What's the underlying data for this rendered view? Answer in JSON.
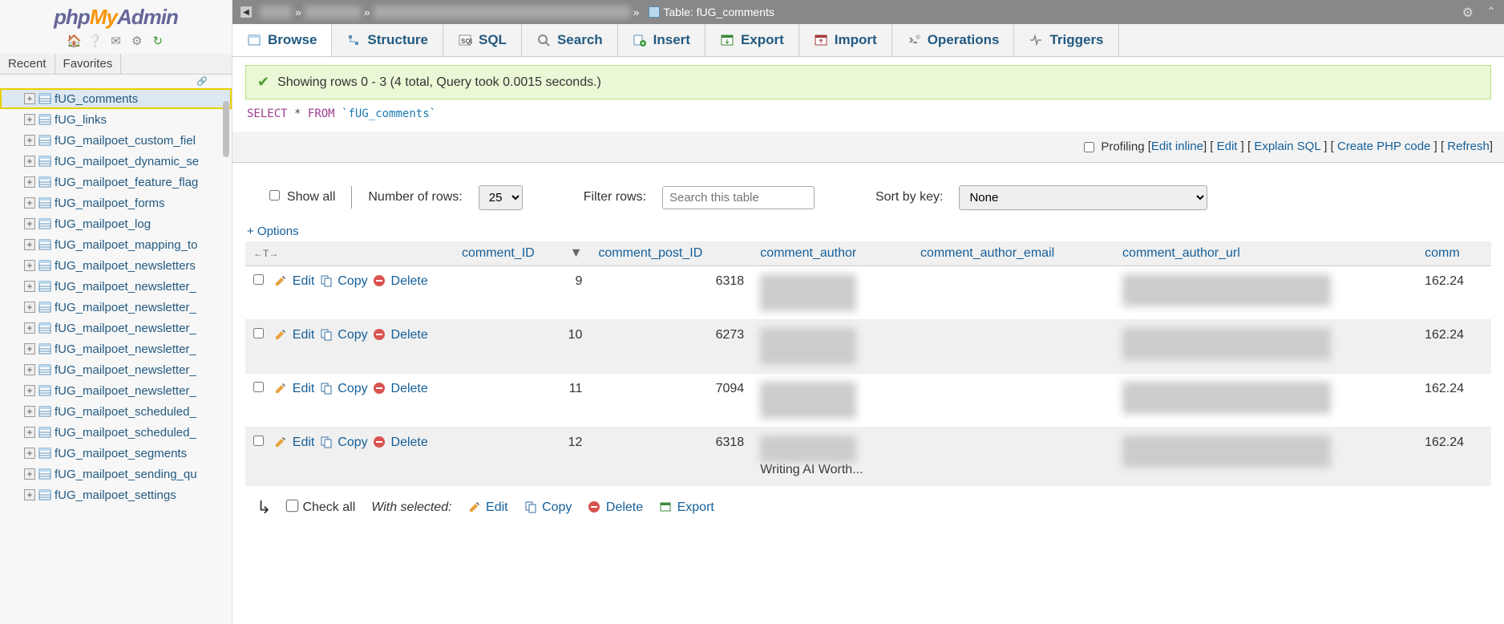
{
  "logo": {
    "p1": "php",
    "p2": "My",
    "p3": "Admin"
  },
  "sidebar_icons": [
    "home-icon",
    "help-icon",
    "sql-icon",
    "settings-icon",
    "reload-icon"
  ],
  "rf_tabs": {
    "recent": "Recent",
    "favorites": "Favorites"
  },
  "tree": [
    {
      "name": "fUG_comments",
      "selected": true
    },
    {
      "name": "fUG_links"
    },
    {
      "name": "fUG_mailpoet_custom_fiel"
    },
    {
      "name": "fUG_mailpoet_dynamic_se"
    },
    {
      "name": "fUG_mailpoet_feature_flag"
    },
    {
      "name": "fUG_mailpoet_forms"
    },
    {
      "name": "fUG_mailpoet_log"
    },
    {
      "name": "fUG_mailpoet_mapping_to"
    },
    {
      "name": "fUG_mailpoet_newsletters"
    },
    {
      "name": "fUG_mailpoet_newsletter_"
    },
    {
      "name": "fUG_mailpoet_newsletter_"
    },
    {
      "name": "fUG_mailpoet_newsletter_"
    },
    {
      "name": "fUG_mailpoet_newsletter_"
    },
    {
      "name": "fUG_mailpoet_newsletter_"
    },
    {
      "name": "fUG_mailpoet_newsletter_"
    },
    {
      "name": "fUG_mailpoet_scheduled_"
    },
    {
      "name": "fUG_mailpoet_scheduled_"
    },
    {
      "name": "fUG_mailpoet_segments"
    },
    {
      "name": "fUG_mailpoet_sending_qu"
    },
    {
      "name": "fUG_mailpoet_settings"
    }
  ],
  "breadcrumb": {
    "sep": "»",
    "table_label": "Table:",
    "table_name": "fUG_comments"
  },
  "tabs": [
    {
      "id": "browse",
      "label": "Browse",
      "active": true
    },
    {
      "id": "structure",
      "label": "Structure"
    },
    {
      "id": "sql",
      "label": "SQL"
    },
    {
      "id": "search",
      "label": "Search"
    },
    {
      "id": "insert",
      "label": "Insert"
    },
    {
      "id": "export",
      "label": "Export"
    },
    {
      "id": "import",
      "label": "Import"
    },
    {
      "id": "operations",
      "label": "Operations"
    },
    {
      "id": "triggers",
      "label": "Triggers"
    }
  ],
  "msg": "Showing rows 0 - 3 (4 total, Query took 0.0015 seconds.)",
  "sql": {
    "select": "SELECT",
    "star": "*",
    "from": "FROM",
    "table": "`fUG_comments`"
  },
  "opts": {
    "profiling": "Profiling",
    "edit_inline": "Edit inline",
    "edit": "Edit",
    "explain": "Explain SQL",
    "create_php": "Create PHP code",
    "refresh": "Refresh"
  },
  "filters": {
    "show_all": "Show all",
    "num_rows_label": "Number of rows:",
    "num_rows_value": "25",
    "filter_label": "Filter rows:",
    "filter_placeholder": "Search this table",
    "sort_label": "Sort by key:",
    "sort_value": "None"
  },
  "plus_options": "+ Options",
  "columns": [
    "comment_ID",
    "comment_post_ID",
    "comment_author",
    "comment_author_email",
    "comment_author_url",
    "comm"
  ],
  "row_actions": {
    "edit": "Edit",
    "copy": "Copy",
    "del": "Delete"
  },
  "rows": [
    {
      "id": "9",
      "post": "6318",
      "ip": "162.24"
    },
    {
      "id": "10",
      "post": "6273",
      "ip": "162.24"
    },
    {
      "id": "11",
      "post": "7094",
      "ip": "162.24"
    },
    {
      "id": "12",
      "post": "6318",
      "ip": "162.24",
      "author_trunc": "Writing AI Worth..."
    }
  ],
  "footer": {
    "check_all": "Check all",
    "with_selected": "With selected:",
    "edit": "Edit",
    "copy": "Copy",
    "del": "Delete",
    "export": "Export"
  }
}
